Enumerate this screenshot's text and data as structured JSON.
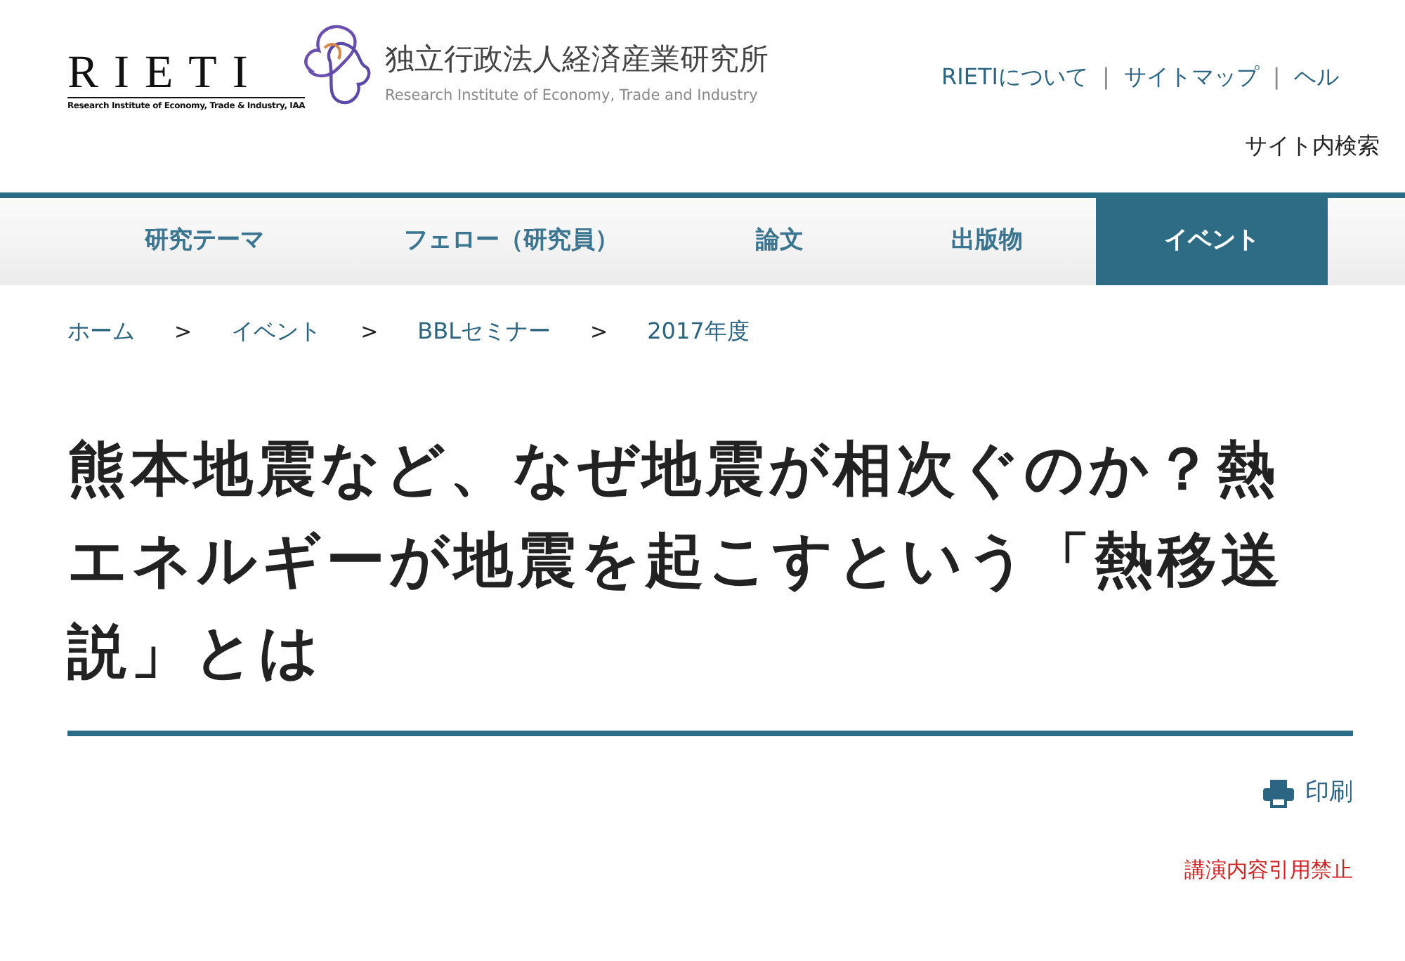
{
  "logo": {
    "wordmark": "RIETI",
    "tagline": "Research Institute of Economy, Trade & Industry, IAA"
  },
  "org": {
    "name_ja": "独立行政法人経済産業研究所",
    "name_en": "Research Institute of Economy, Trade and Industry"
  },
  "top_links": [
    "RIETIについて",
    "サイトマップ",
    "ヘル"
  ],
  "top_link_separator": "|",
  "search_label": "サイト内検索",
  "nav": [
    {
      "label": "研究テーマ",
      "selected": false
    },
    {
      "label": "フェロー（研究員）",
      "selected": false
    },
    {
      "label": "論文",
      "selected": false
    },
    {
      "label": "出版物",
      "selected": false
    },
    {
      "label": "イベント",
      "selected": true
    }
  ],
  "breadcrumb": [
    "ホーム",
    "イベント",
    "BBLセミナー",
    "2017年度"
  ],
  "breadcrumb_separator": ">",
  "title": "熊本地震など、なぜ地震が相次ぐのか？熱エネルギーが地震を起こすという「熱移送説」とは",
  "print_label": "印刷",
  "notice": "講演内容引用禁止"
}
